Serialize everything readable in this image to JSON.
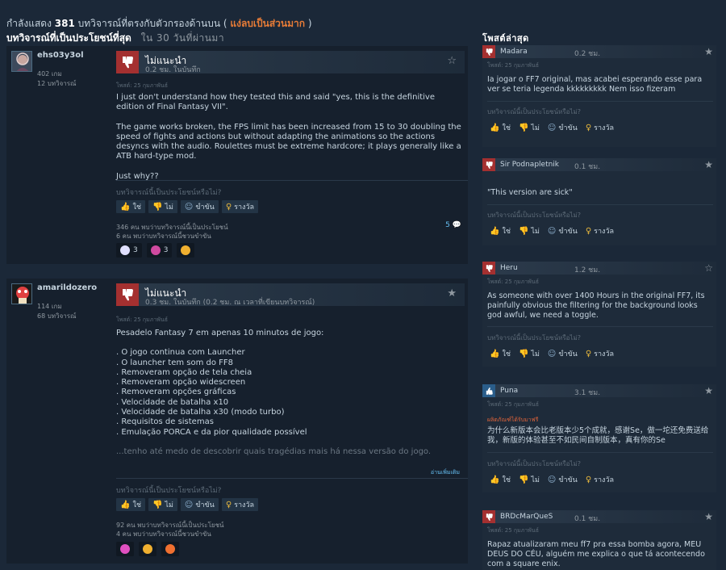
{
  "header": {
    "showing_prefix": "กำลังแสดง",
    "showing_count": "381",
    "showing_suffix": "บทวิจารณ์ที่ตรงกับตัวกรองด้านบน (",
    "filter_link": "แง่ลบเป็นส่วนมาก",
    "showing_close": ")",
    "section_title": "บทวิจารณ์ที่เป็นประโยชน์ที่สุด",
    "range_label": "ใน 30 วันที่ผ่านมา"
  },
  "vote_labels": {
    "helpful_question": "บทวิจารณ์นี้เป็นประโยชน์หรือไม่?",
    "yes": "ใช่",
    "no": "ไม่",
    "funny": "ขำขัน",
    "award": "รางวัล"
  },
  "reviews": [
    {
      "username": "ehs03y3ol",
      "products": "402 เกม",
      "review_count": "12 บทวิจารณ์",
      "verdict": "ไม่แนะนำ",
      "hours": "0.2 ชม. ในบันทึก",
      "posted": "โพสต์: 25 กุมภาพันธ์",
      "paragraphs": [
        "I just don't understand how they tested this and said \"yes, this is the definitive edition of Final Fantasy VII\".",
        "The game works broken, the FPS limit has been increased from 15 to 30 doubling the speed of fights and actions but without adapting the animations so the actions desyncs with the audio. Roulettes must be extreme hardcore; it plays generally like a ATB hard-type mod.",
        "Just why??"
      ],
      "helpful_count": "346 คน พบว่าบทวิจารณ์นี้เป็นประโยชน์",
      "funny_count": "6 คน พบว่าบทวิจารณ์นี้ชวนขำขัน",
      "comments": "5",
      "awards": [
        {
          "icon": "heart-award-icon",
          "count": "3",
          "color": "#e0e0ff"
        },
        {
          "icon": "target-award-icon",
          "count": "3",
          "color": "#d04aa0"
        },
        {
          "icon": "fire-award-icon",
          "count": "",
          "color": "#f0b030"
        }
      ]
    },
    {
      "username": "amarildozero",
      "products": "114 เกม",
      "review_count": "68 บทวิจารณ์",
      "verdict": "ไม่แนะนำ",
      "hours": "0.3 ชม. ในบันทึก (0.2 ชม. ณ เวลาที่เขียนบทวิจารณ์)",
      "posted": "โพสต์: 25 กุมภาพันธ์",
      "intro": "Pesadelo Fantasy 7 em apenas 10 minutos de jogo:",
      "lines": [
        ". O jogo continua com Launcher",
        ". O launcher tem som do FF8",
        ". Removeram opção de tela cheia",
        ". Removeram opção widescreen",
        ". Removeram opções gráficas",
        ". Velocidade de batalha x10",
        ". Velocidade de batalha x30 (modo turbo)",
        ". Requisitos de sistemas",
        ". Emulação PORCA e da pior qualidade possível"
      ],
      "faded": "...tenho até medo de descobrir quais tragédias mais há nessa versão do jogo.",
      "read_more": "อ่านเพิ่มเติม",
      "helpful_count": "92 คน พบว่าบทวิจารณ์นี้เป็นประโยชน์",
      "funny_count": "4 คน พบว่าบทวิจารณ์นี้ชวนขำขัน",
      "awards": [
        {
          "icon": "flower-award-icon",
          "count": "",
          "color": "#e050c0"
        },
        {
          "icon": "fire-award-icon",
          "count": "",
          "color": "#f0b030"
        },
        {
          "icon": "face-award-icon",
          "count": "",
          "color": "#f07030"
        }
      ]
    }
  ],
  "sidebar": {
    "title": "โพสต์ล่าสุด",
    "posts": [
      {
        "name": "Madara",
        "hours": "0.2 ชม.",
        "posted": "โพสต์: 25 กุมภาพันธ์",
        "thumb": "down",
        "text": "Ia jogar o FF7 original, mas acabei esperando esse para ver se teria legenda kkkkkkkkk Nem isso fizeram",
        "note": ""
      },
      {
        "name": "Sir Podnapletnik",
        "hours": "0.1 ชม.",
        "posted": "โพสต์: 25 กุมภาพันธ์",
        "thumb": "down",
        "text": "\"This version are sick\"",
        "note": ""
      },
      {
        "name": "Heru",
        "hours": "1.2 ชม.",
        "posted": "โพสต์: 25 กุมภาพันธ์",
        "thumb": "down",
        "text": "As someone with over 1400 Hours in the original FF7, its painfully obvious the filtering for the background looks god awful, we need a toggle.",
        "note": ""
      },
      {
        "name": "Puna",
        "hours": "3.1 ชม.",
        "posted": "โพสต์: 25 กุมภาพันธ์",
        "thumb": "up",
        "text": "为什么新版本会比老版本少5个成就，感谢Se，做一坨还免费送给我，新版的体验甚至不如民间自制版本，真有你的Se",
        "note": "ผลิตภัณฑ์ได้รับมาฟรี"
      },
      {
        "name": "BRDcMarQueS",
        "hours": "0.1 ชม.",
        "posted": "โพสต์: 25 กุมภาพันธ์",
        "thumb": "down",
        "text": "Rapaz atualizaram meu ff7 pra essa bomba agora, MEU DEUS DO CÉU, alguém me explica o que tá acontecendo com a square enix.",
        "note": ""
      }
    ]
  }
}
